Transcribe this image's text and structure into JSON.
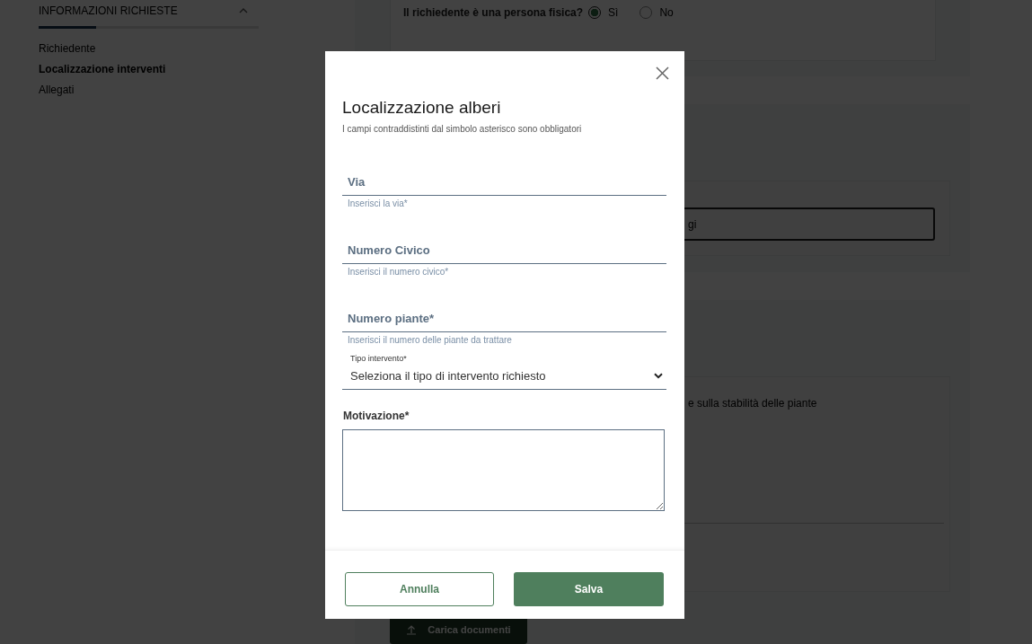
{
  "sidebar": {
    "title": "INFORMAZIONI RICHIESTE",
    "expanded": true,
    "progress": {
      "level": 0.26
    },
    "items": [
      {
        "label": "Richiedente",
        "selected": false
      },
      {
        "label": "Localizzazione interventi",
        "selected": true
      },
      {
        "label": "Allegati",
        "selected": false
      }
    ]
  },
  "background": {
    "question": {
      "label": "Il richiedente è una persona fisica?",
      "options": [
        {
          "label": "Sì",
          "selected": true
        },
        {
          "label": "No",
          "selected": false
        }
      ]
    },
    "search_input": {
      "value": "gi"
    },
    "option_text": "e sulla stabilità delle piante",
    "upload_button": "Carica documenti"
  },
  "modal": {
    "title": "Localizzazione alberi",
    "subtitle": "I campi contraddistinti dal simbolo asterisco sono obbligatori",
    "fields": [
      {
        "kind": "text",
        "placeholder": "Via",
        "hint": "Inserisci la via*"
      },
      {
        "kind": "text",
        "placeholder": "Numero Civico",
        "hint": "Inserisci il numero civico*"
      },
      {
        "kind": "text",
        "placeholder": "Numero piante*",
        "hint": "Inserisci il numero delle piante da trattare"
      },
      {
        "kind": "select",
        "label": "Tipo intervento*",
        "value": "Seleziona il tipo di intervento richiesto"
      },
      {
        "kind": "textarea",
        "label": "Motivazione*"
      }
    ],
    "buttons": [
      {
        "label": "Annulla",
        "kind": "secondary"
      },
      {
        "label": "Salva",
        "kind": "primary"
      }
    ]
  }
}
